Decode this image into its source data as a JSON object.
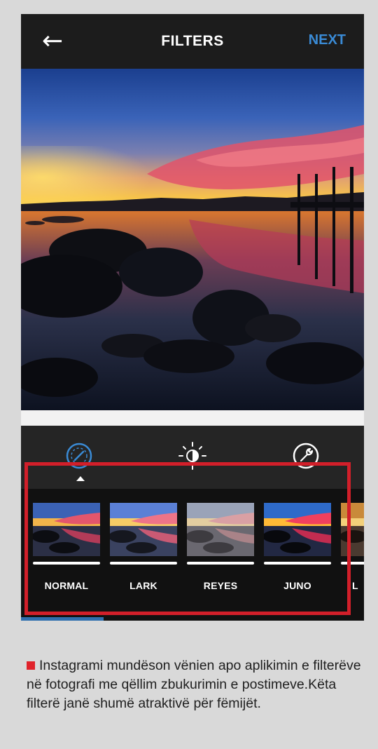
{
  "header": {
    "back_icon": "arrow-left-icon",
    "back_glyph": "←",
    "title": "FILTERS",
    "next_label": "NEXT"
  },
  "toolbar": {
    "tools": [
      {
        "name": "filter-icon",
        "active": true
      },
      {
        "name": "brightness-icon",
        "active": false
      },
      {
        "name": "wrench-icon",
        "active": false
      }
    ]
  },
  "filters": [
    {
      "label": "NORMAL"
    },
    {
      "label": "LARK"
    },
    {
      "label": "REYES"
    },
    {
      "label": "JUNO"
    },
    {
      "label": "L"
    }
  ],
  "caption": {
    "text": "Instagrami mundëson vënien apo aplikimin e filterëve në fotografi me qëllim zbukurimin e postimeve.Këta filterë janë shumë atraktivë për fëmijët."
  },
  "colors": {
    "accent": "#3a8bd6",
    "highlight": "#d21f2a",
    "bullet": "#e0232b",
    "background": "#d9d9d9"
  }
}
